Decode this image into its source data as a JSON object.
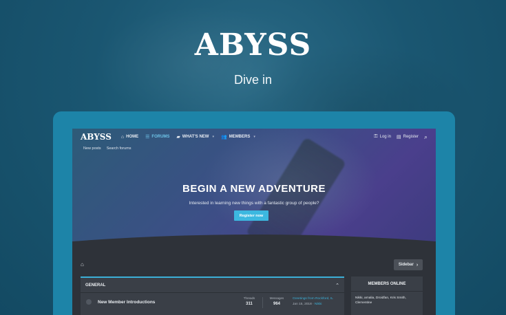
{
  "hero": {
    "title": "ABYSS",
    "tagline": "Dive in"
  },
  "site": {
    "logo": "ABYSS",
    "nav": [
      {
        "label": "HOME",
        "icon": "home-icon",
        "active": false
      },
      {
        "label": "FORUMS",
        "icon": "forums-icon",
        "active": true
      },
      {
        "label": "WHAT'S NEW",
        "icon": "whats-new-icon",
        "active": false
      },
      {
        "label": "MEMBERS",
        "icon": "members-icon",
        "active": false
      }
    ],
    "login_label": "Log in",
    "register_label": "Register",
    "subnav": [
      "New posts",
      "Search forums"
    ],
    "cta_title": "BEGIN A NEW ADVENTURE",
    "cta_subtitle": "Interested in learning new things with a fantastic group of people?",
    "cta_button": "Register now",
    "sidebar_button": "Sidebar",
    "category": "GENERAL",
    "forum": {
      "name": "New Member Introductions",
      "threads_label": "Threads",
      "threads": "311",
      "messages_label": "Messages",
      "messages": "964",
      "last_post_title": "Greetings from Rockford, IL",
      "last_post_date": "Jan 15, 2018",
      "last_post_user": "Nikki"
    },
    "members_online_title": "MEMBERS ONLINE",
    "members_online": "Nikki, amalia, Droidfan, Kris Smith, Clementine"
  },
  "colors": {
    "accent": "#3cb8e0",
    "device_frame": "#1d84a8",
    "background": "#1a5671"
  }
}
